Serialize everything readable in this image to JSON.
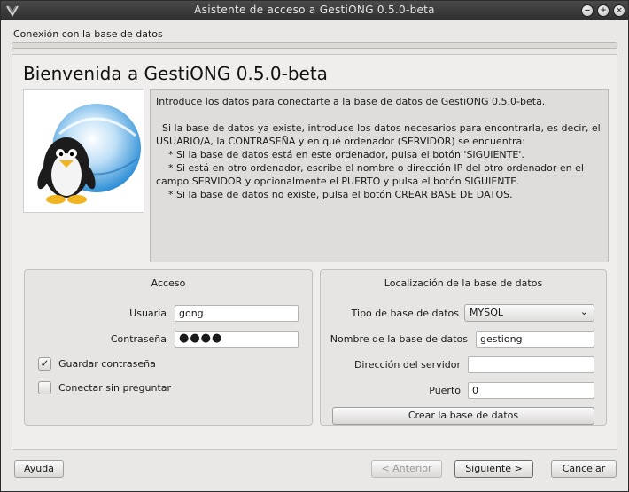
{
  "window": {
    "title": "Asistente de acceso a GestiONG 0.5.0-beta",
    "controls": {
      "minimize": "‒",
      "maximize": "+",
      "close": "×"
    }
  },
  "header": {
    "section": "Conexión con la base de datos"
  },
  "main": {
    "heading": "Bienvenida a GestiONG 0.5.0-beta",
    "intro_text": "Introduce los datos para conectarte a la base de datos de GestiONG 0.5.0-beta.\n\n  Si la base de datos ya existe, introduce los datos necesarios para encontrarla, es decir, el USUARIO/A, la CONTRASEÑA y en qué ordenador (SERVIDOR) se encuentra:\n    * Si la base de datos está en este ordenador, pulsa el botón 'SIGUIENTE'.\n    * Si está en otro ordenador, escribe el nombre o dirección IP del otro ordenador en el campo SERVIDOR y opcionalmente el PUERTO y pulsa el botón SIGUIENTE.\n    * Si la base de datos no existe, pulsa el botón CREAR BASE DE DATOS."
  },
  "acceso": {
    "title": "Acceso",
    "user_label": "Usuaria",
    "user_value": "gong",
    "password_label": "Contraseña",
    "password_value": "●●●●",
    "save_password_label": "Guardar contraseña",
    "save_password_checked": "✓",
    "auto_connect_label": "Conectar sin preguntar"
  },
  "localizacion": {
    "title": "Localización de la base de datos",
    "db_type_label": "Tipo de base de datos",
    "db_type_value": "MYSQL",
    "db_name_label": "Nombre de la base de datos",
    "db_name_value": "gestiong",
    "server_label": "Dirección del servidor",
    "server_value": "",
    "port_label": "Puerto",
    "port_value": "0",
    "create_db_button": "Crear la base de datos"
  },
  "footer": {
    "help_button": "Ayuda",
    "back_button": "< Anterior",
    "next_button": "Siguiente >",
    "cancel_button": "Cancelar"
  },
  "icons": {
    "app": "gestiong-app-icon",
    "logo": "penguin-globe-logo",
    "dropdown": "chevron-down-icon",
    "check": "checkmark-icon"
  }
}
